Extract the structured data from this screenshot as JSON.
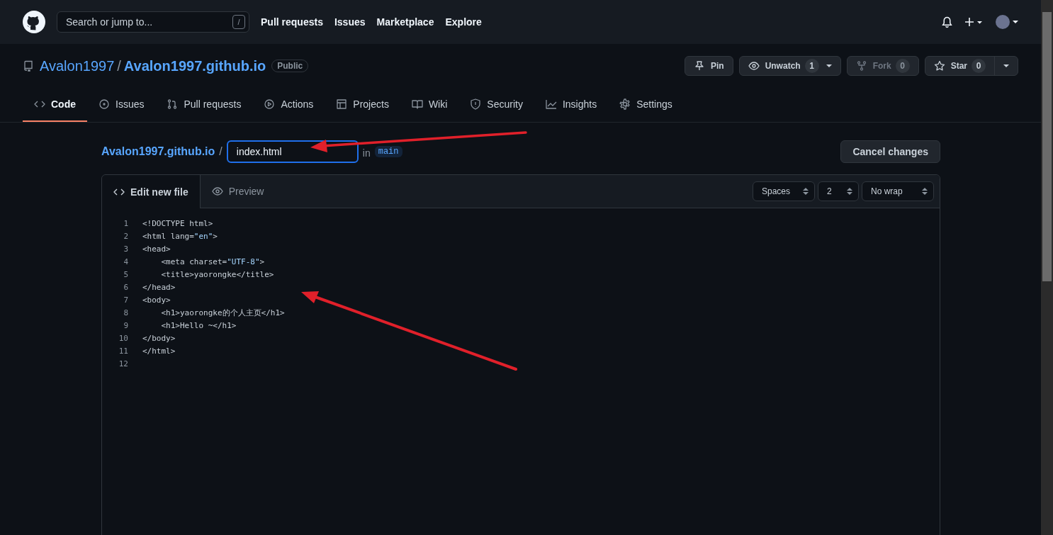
{
  "header": {
    "search_placeholder": "Search or jump to...",
    "search_key": "/",
    "nav": [
      "Pull requests",
      "Issues",
      "Marketplace",
      "Explore"
    ]
  },
  "repo": {
    "owner": "Avalon1997",
    "separator": "/",
    "name": "Avalon1997.github.io",
    "visibility": "Public",
    "actions": [
      {
        "label": "Pin",
        "kind": "plain",
        "disabled": false
      },
      {
        "label": "Unwatch",
        "count": "1",
        "kind": "menu",
        "disabled": false
      },
      {
        "label": "Fork",
        "count": "0",
        "kind": "plain",
        "disabled": true
      },
      {
        "label": "Star",
        "count": "0",
        "kind": "split",
        "disabled": false
      }
    ]
  },
  "tabs": [
    {
      "label": "Code",
      "selected": true
    },
    {
      "label": "Issues",
      "selected": false
    },
    {
      "label": "Pull requests",
      "selected": false
    },
    {
      "label": "Actions",
      "selected": false
    },
    {
      "label": "Projects",
      "selected": false
    },
    {
      "label": "Wiki",
      "selected": false
    },
    {
      "label": "Security",
      "selected": false
    },
    {
      "label": "Insights",
      "selected": false
    },
    {
      "label": "Settings",
      "selected": false
    }
  ],
  "editor": {
    "path_repo": "Avalon1997.github.io",
    "path_separator": "/",
    "filename": "index.html",
    "branch_prefix": "in",
    "branch": "main",
    "cancel_button": "Cancel changes",
    "tabs": [
      {
        "label": "Edit new file",
        "selected": true
      },
      {
        "label": "Preview",
        "selected": false
      }
    ],
    "selects": [
      "Spaces",
      "2",
      "No wrap"
    ],
    "lines": [
      {
        "number": "1",
        "segments": [
          {
            "kind": "plain",
            "text": "<!DOCTYPE html>"
          }
        ]
      },
      {
        "number": "2",
        "segments": [
          {
            "kind": "plain",
            "text": "<html lang="
          },
          {
            "kind": "string",
            "text": "\"en\""
          },
          {
            "kind": "plain",
            "text": ">"
          }
        ]
      },
      {
        "number": "3",
        "segments": [
          {
            "kind": "plain",
            "text": "<head>"
          }
        ]
      },
      {
        "number": "4",
        "segments": [
          {
            "kind": "plain",
            "text": "    <meta charset="
          },
          {
            "kind": "string",
            "text": "\"UTF-8\""
          },
          {
            "kind": "plain",
            "text": ">"
          }
        ]
      },
      {
        "number": "5",
        "segments": [
          {
            "kind": "plain",
            "text": "    <title>yaorongke</title>"
          }
        ]
      },
      {
        "number": "6",
        "segments": [
          {
            "kind": "plain",
            "text": "</head>"
          }
        ]
      },
      {
        "number": "7",
        "segments": [
          {
            "kind": "plain",
            "text": "<body>"
          }
        ]
      },
      {
        "number": "8",
        "segments": [
          {
            "kind": "plain",
            "text": "    <h1>yaorongke的个人主页</h1>"
          }
        ]
      },
      {
        "number": "9",
        "segments": [
          {
            "kind": "plain",
            "text": "    <h1>Hello ~</h1>"
          }
        ]
      },
      {
        "number": "10",
        "segments": [
          {
            "kind": "plain",
            "text": "</body>"
          }
        ]
      },
      {
        "number": "11",
        "segments": [
          {
            "kind": "plain",
            "text": "</html>"
          }
        ]
      },
      {
        "number": "12"
      }
    ]
  }
}
